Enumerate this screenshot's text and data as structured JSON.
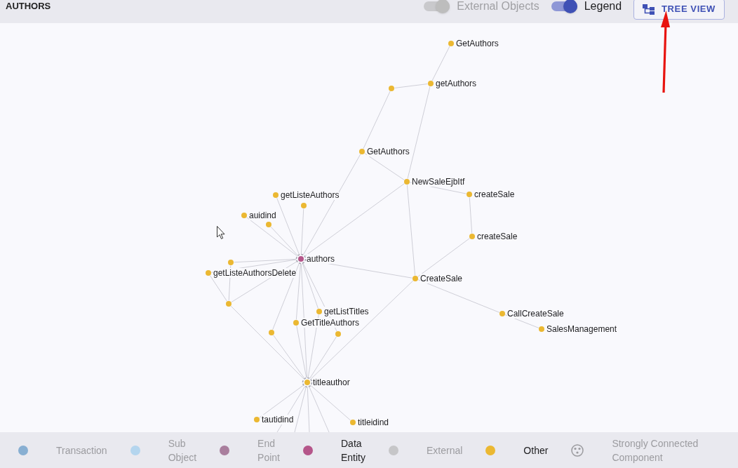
{
  "header": {
    "title": "AUTHORS",
    "toggles": [
      {
        "label": "External Objects",
        "on": true,
        "disabled": true
      },
      {
        "label": "Legend",
        "on": true,
        "disabled": false
      }
    ],
    "tree_view_button": {
      "label": "TREE VIEW"
    }
  },
  "graph": {
    "nodes": [
      {
        "label": "GetAuthors",
        "kind": "other"
      },
      {
        "label": "getAuthors",
        "kind": "other"
      },
      {
        "kind": "other"
      },
      {
        "label": "GetAuthors",
        "kind": "other"
      },
      {
        "label": "NewSaleEjbItf",
        "kind": "other"
      },
      {
        "label": "createSale",
        "kind": "other"
      },
      {
        "label": "getListeAuthors",
        "kind": "other"
      },
      {
        "kind": "other"
      },
      {
        "label": "auidind",
        "kind": "other"
      },
      {
        "kind": "other"
      },
      {
        "label": "createSale",
        "kind": "other"
      },
      {
        "label": "authors",
        "kind": "data_entity"
      },
      {
        "kind": "other"
      },
      {
        "label": "getListeAuthorsDelete",
        "kind": "other"
      },
      {
        "label": "CreateSale",
        "kind": "other"
      },
      {
        "kind": "other"
      },
      {
        "label": "getListTitles",
        "kind": "other"
      },
      {
        "label": "CallCreateSale",
        "kind": "other"
      },
      {
        "label": "GetTitleAuthors",
        "kind": "other"
      },
      {
        "kind": "other"
      },
      {
        "kind": "other"
      },
      {
        "label": "SalesManagement",
        "kind": "other"
      },
      {
        "label": "titleauthor",
        "kind": "other"
      },
      {
        "label": "tautidind",
        "kind": "other"
      },
      {
        "label": "titleidind",
        "kind": "other"
      }
    ]
  },
  "legend": {
    "items": [
      {
        "label": "Transaction",
        "kind": "dot",
        "color": "#88afd2",
        "active": false
      },
      {
        "label": "Sub Object",
        "kind": "dot",
        "color": "#b4d5ee",
        "active": false
      },
      {
        "label": "End Point",
        "kind": "dot",
        "color": "#a97e9d",
        "active": false
      },
      {
        "label": "Data Entity",
        "kind": "dot",
        "color": "#b5568a",
        "active": true
      },
      {
        "label": "External",
        "kind": "dot",
        "color": "#c6c6c8",
        "active": false
      },
      {
        "label": "Other",
        "kind": "dot",
        "color": "#ebb832",
        "active": true
      },
      {
        "label": "Strongly Connected Component",
        "kind": "scc",
        "active": false
      }
    ]
  }
}
